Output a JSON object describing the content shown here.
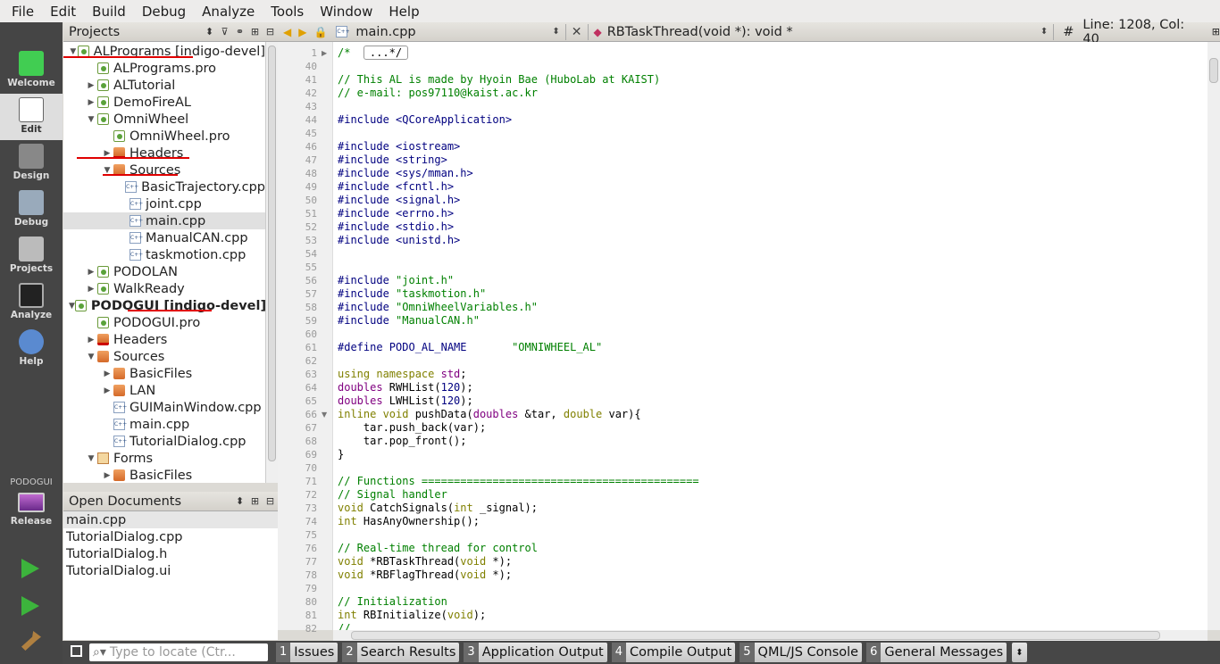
{
  "menu": [
    "File",
    "Edit",
    "Build",
    "Debug",
    "Analyze",
    "Tools",
    "Window",
    "Help"
  ],
  "modes": [
    {
      "label": "Welcome",
      "icon": "qt-logo-icon",
      "active": false
    },
    {
      "label": "Edit",
      "icon": "edit-document-icon",
      "active": true
    },
    {
      "label": "Design",
      "icon": "design-pen-icon",
      "active": false
    },
    {
      "label": "Debug",
      "icon": "debug-bug-icon",
      "active": false
    },
    {
      "label": "Projects",
      "icon": "projects-icon",
      "active": false
    },
    {
      "label": "Analyze",
      "icon": "analyze-scope-icon",
      "active": false
    },
    {
      "label": "Help",
      "icon": "help-question-icon",
      "active": false
    }
  ],
  "kit": {
    "project": "PODOGUI",
    "config": "Release"
  },
  "projects_panel": {
    "title": "Projects"
  },
  "tree": [
    {
      "label": "ALPrograms [indigo-devel]",
      "arrow": "down",
      "icon": "pro",
      "indent": 0,
      "bold": false,
      "underline": true
    },
    {
      "label": "ALPrograms.pro",
      "arrow": "",
      "icon": "pro",
      "indent": 1
    },
    {
      "label": "ALTutorial",
      "arrow": "right",
      "icon": "pro",
      "indent": 1
    },
    {
      "label": "DemoFireAL",
      "arrow": "right",
      "icon": "pro",
      "indent": 1
    },
    {
      "label": "OmniWheel",
      "arrow": "down",
      "icon": "pro",
      "indent": 1,
      "underline": true
    },
    {
      "label": "OmniWheel.pro",
      "arrow": "",
      "icon": "pro",
      "indent": 2
    },
    {
      "label": "Headers",
      "arrow": "right",
      "icon": "hfold",
      "indent": 2
    },
    {
      "label": "Sources",
      "arrow": "down",
      "icon": "folder",
      "indent": 2,
      "underline": true
    },
    {
      "label": "BasicTrajectory.cpp",
      "arrow": "",
      "icon": "cpp",
      "indent": 3
    },
    {
      "label": "joint.cpp",
      "arrow": "",
      "icon": "cpp",
      "indent": 3
    },
    {
      "label": "main.cpp",
      "arrow": "",
      "icon": "cpp",
      "indent": 3,
      "selected": true,
      "underline": true
    },
    {
      "label": "ManualCAN.cpp",
      "arrow": "",
      "icon": "cpp",
      "indent": 3
    },
    {
      "label": "taskmotion.cpp",
      "arrow": "",
      "icon": "cpp",
      "indent": 3
    },
    {
      "label": "PODOLAN",
      "arrow": "right",
      "icon": "pro",
      "indent": 1
    },
    {
      "label": "WalkReady",
      "arrow": "right",
      "icon": "pro",
      "indent": 1
    },
    {
      "label": "PODOGUI [indigo-devel]",
      "arrow": "down",
      "icon": "pro",
      "indent": 0,
      "bold": true
    },
    {
      "label": "PODOGUI.pro",
      "arrow": "",
      "icon": "pro",
      "indent": 1
    },
    {
      "label": "Headers",
      "arrow": "right",
      "icon": "hfold",
      "indent": 1
    },
    {
      "label": "Sources",
      "arrow": "down",
      "icon": "folder",
      "indent": 1
    },
    {
      "label": "BasicFiles",
      "arrow": "right",
      "icon": "folder",
      "indent": 2
    },
    {
      "label": "LAN",
      "arrow": "right",
      "icon": "folder",
      "indent": 2
    },
    {
      "label": "GUIMainWindow.cpp",
      "arrow": "",
      "icon": "cpp",
      "indent": 2
    },
    {
      "label": "main.cpp",
      "arrow": "",
      "icon": "cpp",
      "indent": 2
    },
    {
      "label": "TutorialDialog.cpp",
      "arrow": "",
      "icon": "cpp",
      "indent": 2
    },
    {
      "label": "Forms",
      "arrow": "down",
      "icon": "frm",
      "indent": 1
    },
    {
      "label": "BasicFiles",
      "arrow": "right",
      "icon": "folder",
      "indent": 2
    }
  ],
  "open_documents": {
    "title": "Open Documents",
    "items": [
      "main.cpp",
      "TutorialDialog.cpp",
      "TutorialDialog.h",
      "TutorialDialog.ui"
    ],
    "selected": 0
  },
  "editor": {
    "file": "main.cpp",
    "symbol": "RBTaskThread(void *): void *",
    "position": "Line: 1208, Col: 40",
    "hash": "#"
  },
  "code_lines": [
    {
      "n": "1",
      "fold": "▶",
      "h": "<span class='c-com'>/* </span> <span class='fold-box'>...*/</span>"
    },
    {
      "n": "40",
      "h": ""
    },
    {
      "n": "41",
      "h": "<span class='c-com'>// This AL is made by Hyoin Bae (HuboLab at KAIST)</span>"
    },
    {
      "n": "42",
      "h": "<span class='c-com'>// e-mail: pos97110@kaist.ac.kr</span>"
    },
    {
      "n": "43",
      "h": ""
    },
    {
      "n": "44",
      "h": "<span class='c-pp'>#include &lt;QCoreApplication&gt;</span>"
    },
    {
      "n": "45",
      "h": ""
    },
    {
      "n": "46",
      "h": "<span class='c-pp'>#include &lt;iostream&gt;</span>"
    },
    {
      "n": "47",
      "h": "<span class='c-pp'>#include &lt;string&gt;</span>"
    },
    {
      "n": "48",
      "h": "<span class='c-pp'>#include &lt;sys/mman.h&gt;</span>"
    },
    {
      "n": "49",
      "h": "<span class='c-pp'>#include &lt;fcntl.h&gt;</span>"
    },
    {
      "n": "50",
      "h": "<span class='c-pp'>#include &lt;signal.h&gt;</span>"
    },
    {
      "n": "51",
      "h": "<span class='c-pp'>#include &lt;errno.h&gt;</span>"
    },
    {
      "n": "52",
      "h": "<span class='c-pp'>#include &lt;stdio.h&gt;</span>"
    },
    {
      "n": "53",
      "h": "<span class='c-pp'>#include &lt;unistd.h&gt;</span>"
    },
    {
      "n": "54",
      "h": ""
    },
    {
      "n": "55",
      "h": ""
    },
    {
      "n": "56",
      "h": "<span class='c-pp'>#include </span><span class='c-str'>\"joint.h\"</span>"
    },
    {
      "n": "57",
      "h": "<span class='c-pp'>#include </span><span class='c-str'>\"taskmotion.h\"</span>"
    },
    {
      "n": "58",
      "h": "<span class='c-pp'>#include </span><span class='c-str'>\"OmniWheelVariables.h\"</span>"
    },
    {
      "n": "59",
      "h": "<span class='c-pp'>#include </span><span class='c-str'>\"ManualCAN.h\"</span>"
    },
    {
      "n": "60",
      "h": ""
    },
    {
      "n": "61",
      "h": "<span class='c-pp'>#define PODO_AL_NAME       </span><span class='c-str'>\"OMNIWHEEL_AL\"</span>"
    },
    {
      "n": "62",
      "h": ""
    },
    {
      "n": "63",
      "h": "<span class='c-kw'>using namespace</span> <span class='c-mac'>std</span>;"
    },
    {
      "n": "64",
      "h": "<span class='c-mac'>doubles</span> RWHList(<span class='c-num'>120</span>);"
    },
    {
      "n": "65",
      "h": "<span class='c-mac'>doubles</span> LWHList(<span class='c-num'>120</span>);"
    },
    {
      "n": "66",
      "fold": "▼",
      "h": "<span class='c-kw'>inline void</span> pushData(<span class='c-mac'>doubles</span> &amp;tar, <span class='c-kw'>double</span> var){"
    },
    {
      "n": "67",
      "h": "    tar.push_back(var);"
    },
    {
      "n": "68",
      "h": "    tar.pop_front();"
    },
    {
      "n": "69",
      "h": "}"
    },
    {
      "n": "70",
      "h": ""
    },
    {
      "n": "71",
      "h": "<span class='c-com'>// Functions ===========================================</span>"
    },
    {
      "n": "72",
      "h": "<span class='c-com'>// Signal handler</span>"
    },
    {
      "n": "73",
      "h": "<span class='c-kw'>void</span> CatchSignals(<span class='c-kw'>int</span> _signal);"
    },
    {
      "n": "74",
      "h": "<span class='c-kw'>int</span> HasAnyOwnership();"
    },
    {
      "n": "75",
      "h": ""
    },
    {
      "n": "76",
      "h": "<span class='c-com'>// Real-time thread for control</span>"
    },
    {
      "n": "77",
      "h": "<span class='c-kw'>void</span> *RBTaskThread(<span class='c-kw'>void</span> *);"
    },
    {
      "n": "78",
      "h": "<span class='c-kw'>void</span> *RBFlagThread(<span class='c-kw'>void</span> *);"
    },
    {
      "n": "79",
      "h": ""
    },
    {
      "n": "80",
      "h": "<span class='c-com'>// Initialization</span>"
    },
    {
      "n": "81",
      "h": "<span class='c-kw'>int</span> RBInitialize(<span class='c-kw'>void</span>);"
    },
    {
      "n": "82",
      "h": "<span class='c-com'>//</span>"
    }
  ],
  "statusbar": {
    "locate_placeholder": "Type to locate (Ctr...",
    "panes": [
      {
        "n": "1",
        "label": "Issues"
      },
      {
        "n": "2",
        "label": "Search Results"
      },
      {
        "n": "3",
        "label": "Application Output"
      },
      {
        "n": "4",
        "label": "Compile Output"
      },
      {
        "n": "5",
        "label": "QML/JS Console"
      },
      {
        "n": "6",
        "label": "General Messages"
      }
    ]
  }
}
